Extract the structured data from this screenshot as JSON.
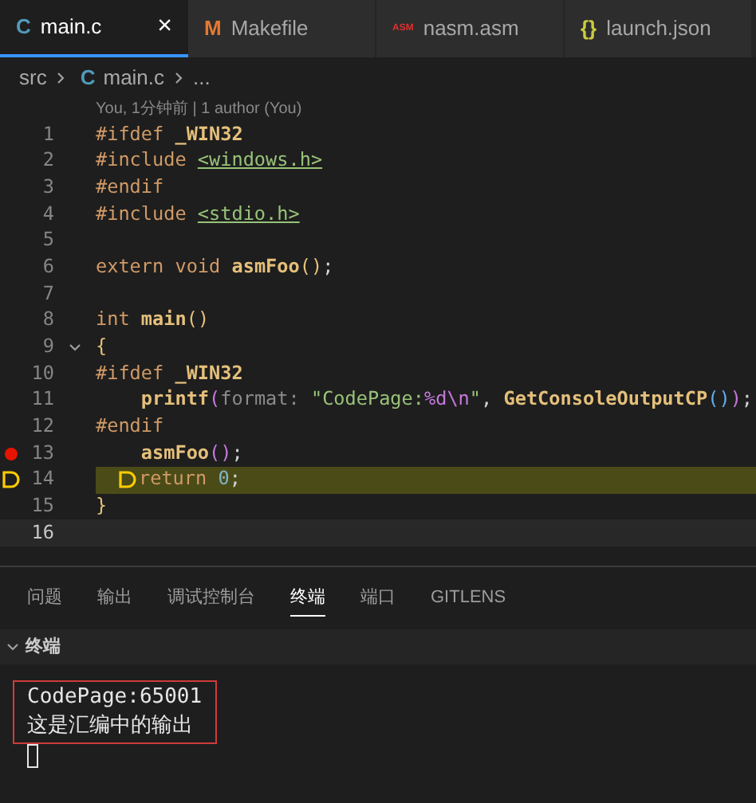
{
  "tabs": [
    {
      "icon": "C",
      "color": "#519aba",
      "label": "main.c",
      "selected": true,
      "closable": true
    },
    {
      "icon": "M",
      "color": "#e37933",
      "label": "Makefile",
      "selected": false,
      "closable": false
    },
    {
      "icon": "ASM",
      "color": "#d9302f",
      "label": "nasm.asm",
      "selected": false,
      "closable": false
    },
    {
      "icon": "{}",
      "color": "#cbcb41",
      "label": "launch.json",
      "selected": false,
      "closable": false
    }
  ],
  "close_glyph": "×",
  "breadcrumb": {
    "folder": "src",
    "file_icon": "C",
    "file": "main.c",
    "more": "..."
  },
  "codelens": "You, 1分钟前 | 1 author (You)",
  "lines": [
    {
      "number": "1",
      "tokens": [
        {
          "t": "#ifdef ",
          "kind": "pre"
        },
        {
          "t": "_WIN32",
          "kind": "macro"
        }
      ]
    },
    {
      "number": "2",
      "tokens": [
        {
          "t": "#include ",
          "kind": "pre"
        },
        {
          "t": "<windows.h>",
          "kind": "inc"
        }
      ]
    },
    {
      "number": "3",
      "tokens": [
        {
          "t": "#endif",
          "kind": "pre"
        }
      ]
    },
    {
      "number": "4",
      "tokens": [
        {
          "t": "#include ",
          "kind": "pre"
        },
        {
          "t": "<stdio.h>",
          "kind": "inc"
        }
      ]
    },
    {
      "number": "5"
    },
    {
      "number": "6",
      "tokens": [
        {
          "t": "extern void ",
          "kind": "kw"
        },
        {
          "t": "asmFoo",
          "kind": "fn"
        },
        {
          "t": "()",
          "kind": "paren"
        },
        {
          "t": ";",
          "kind": "plain"
        }
      ]
    },
    {
      "number": "7"
    },
    {
      "number": "8",
      "tokens": [
        {
          "t": "int ",
          "kind": "kw"
        },
        {
          "t": "main",
          "kind": "fn"
        },
        {
          "t": "()",
          "kind": "paren"
        }
      ]
    },
    {
      "number": "9",
      "fold": true,
      "tokens": [
        {
          "t": "{",
          "kind": "paren"
        }
      ]
    },
    {
      "number": "10",
      "tokens": [
        {
          "t": "#ifdef ",
          "kind": "pre"
        },
        {
          "t": "_WIN32",
          "kind": "macro"
        }
      ]
    },
    {
      "number": "11",
      "tokens": [
        {
          "t": "    printf",
          "kind": "fn"
        },
        {
          "t": "(",
          "kind": "paren2"
        },
        {
          "t": "format: ",
          "kind": "hint"
        },
        {
          "t": "\"CodePage:",
          "kind": "str"
        },
        {
          "t": "%d\\n",
          "kind": "esc"
        },
        {
          "t": "\"",
          "kind": "str"
        },
        {
          "t": ", ",
          "kind": "plain"
        },
        {
          "t": "GetConsoleOutputCP",
          "kind": "fn"
        },
        {
          "t": "()",
          "kind": "paren3"
        },
        {
          "t": ")",
          "kind": "paren2"
        },
        {
          "t": ";",
          "kind": "plain"
        }
      ]
    },
    {
      "number": "12",
      "tokens": [
        {
          "t": "#endif",
          "kind": "pre"
        }
      ]
    },
    {
      "number": "13",
      "breakpoint": true,
      "tokens": [
        {
          "t": "    asmFoo",
          "kind": "fn"
        },
        {
          "t": "()",
          "kind": "paren2"
        },
        {
          "t": ";",
          "kind": "plain"
        }
      ]
    },
    {
      "number": "14",
      "current": true,
      "tokens": [
        {
          "t": "return ",
          "kind": "kw"
        },
        {
          "t": "0",
          "kind": "num"
        },
        {
          "t": ";",
          "kind": "plain"
        }
      ]
    },
    {
      "number": "15",
      "tokens": [
        {
          "t": "}",
          "kind": "paren"
        }
      ]
    },
    {
      "number": "16",
      "active": true
    }
  ],
  "panel_tabs": [
    {
      "label": "问题",
      "selected": false
    },
    {
      "label": "输出",
      "selected": false
    },
    {
      "label": "调试控制台",
      "selected": false
    },
    {
      "label": "终端",
      "selected": true
    },
    {
      "label": "端口",
      "selected": false
    },
    {
      "label": "GITLENS",
      "selected": false
    }
  ],
  "terminal": {
    "title": "终端",
    "expanded": true,
    "highlighted": [
      "CodePage:65001",
      "这是汇编中的输出"
    ]
  }
}
